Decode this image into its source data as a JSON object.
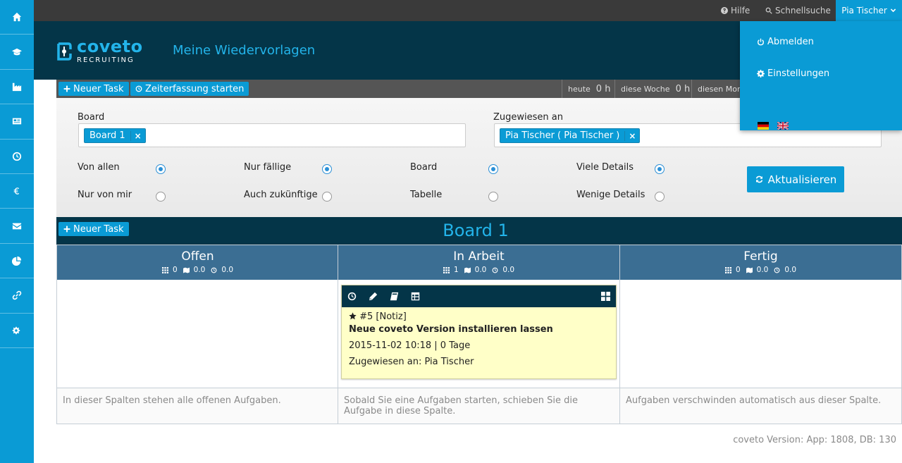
{
  "sidebar": {
    "icons": [
      "home-icon",
      "graduation-cap-icon",
      "factory-icon",
      "newspaper-icon",
      "clock-icon",
      "euro-icon",
      "envelope-icon",
      "pie-chart-icon",
      "link-icon",
      "cogs-icon"
    ]
  },
  "topbar": {
    "help_label": "Hilfe",
    "quicksearch_label": "Schnellsuche",
    "user_label": "Pia Tischer"
  },
  "user_dropdown": {
    "logout_label": "Abmelden",
    "settings_label": "Einstellungen",
    "languages": [
      "de-flag-icon",
      "uk-flag-icon"
    ]
  },
  "header": {
    "logo_name": "coveto",
    "logo_sub": "RECRUITING",
    "title": "Meine Wiedervorlagen"
  },
  "toolbar": {
    "new_task_label": "Neuer Task",
    "timer_label": "Zeiterfassung starten",
    "stats": [
      {
        "label": "heute",
        "value": "0 h"
      },
      {
        "label": "diese Woche",
        "value": "0 h"
      },
      {
        "label": "diesen Mona",
        "value": ""
      }
    ]
  },
  "filters": {
    "board_label": "Board",
    "board_tag": "Board 1",
    "assigned_label": "Zugewiesen an",
    "assigned_tag": "Pia Tischer ( Pia Tischer )",
    "tag_remove": "×",
    "options": {
      "from_all": "Von allen",
      "only_mine": "Nur von mir",
      "only_due": "Nur fällige",
      "future_too": "Auch zukünftige",
      "board": "Board",
      "table": "Tabelle",
      "many_details": "Viele Details",
      "few_details": "Wenige Details"
    },
    "refresh_label": "Aktualisieren"
  },
  "board": {
    "new_task_label": "Neuer Task",
    "title": "Board 1",
    "columns": [
      {
        "title": "Offen",
        "count": "0",
        "hours": "0.0",
        "time": "0.0",
        "footer": "In dieser Spalten stehen alle offenen Aufgaben."
      },
      {
        "title": "In Arbeit",
        "count": "1",
        "hours": "0.0",
        "time": "0.0",
        "footer": "Sobald Sie eine Aufgaben starten, schieben Sie die Aufgabe in diese Spalte."
      },
      {
        "title": "Fertig",
        "count": "0",
        "hours": "0.0",
        "time": "0.0",
        "footer": "Aufgaben verschwinden automatisch aus dieser Spalte."
      }
    ]
  },
  "task": {
    "id_type": "#5 [Notiz]",
    "title": "Neue coveto Version installieren lassen",
    "date_line": "2015-11-02 10:18 | 0 Tage",
    "assigned_line": "Zugewiesen an: Pia Tischer"
  },
  "version": "coveto Version: App: 1808, DB: 130"
}
